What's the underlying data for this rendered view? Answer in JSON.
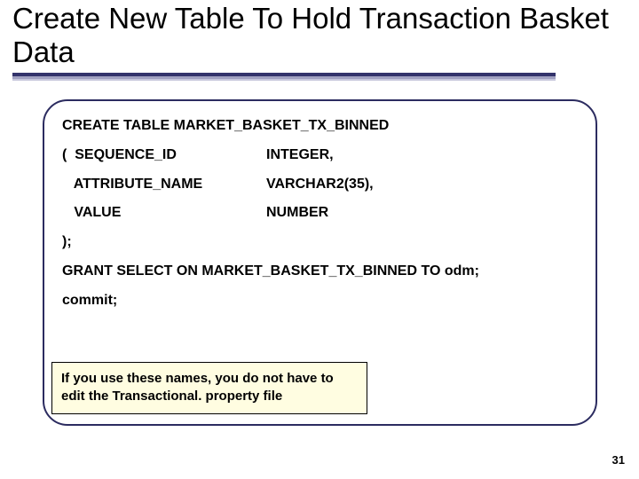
{
  "title": "Create New Table To Hold Transaction Basket Data",
  "sql": {
    "create": "CREATE TABLE MARKET_BASKET_TX_BINNED",
    "cols": [
      {
        "name": "(  SEQUENCE_ID",
        "type": "INTEGER,"
      },
      {
        "name": "   ATTRIBUTE_NAME",
        "type": "VARCHAR2(35),"
      },
      {
        "name": "   VALUE",
        "type": "NUMBER"
      }
    ],
    "close": ");",
    "grant": "GRANT SELECT ON MARKET_BASKET_TX_BINNED TO odm;",
    "commit": "commit;"
  },
  "note": "If you use these names, you do not have to edit the Transactional. property file",
  "page_number": "31"
}
